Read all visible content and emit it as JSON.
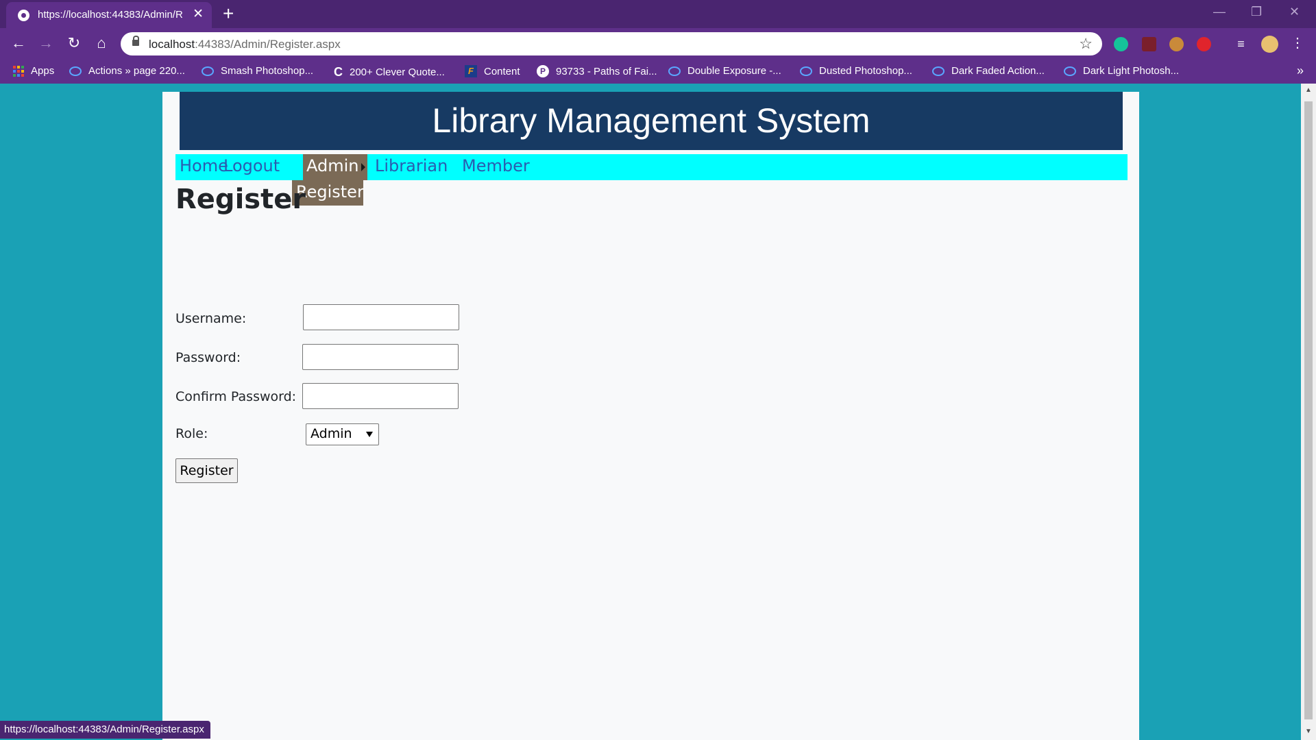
{
  "browser": {
    "tab_title": "https://localhost:44383/Admin/R",
    "new_tab": "+",
    "url_host": "localhost",
    "url_rest": ":44383/Admin/Register.aspx",
    "back": "←",
    "forward": "→",
    "reload": "↻",
    "home": "⌂",
    "star": "☆",
    "menu": "⋮",
    "window_min": "—",
    "window_max": "❐",
    "window_close": "✕",
    "bookmarks_more": "»",
    "status_url": "https://localhost:44383/Admin/Register.aspx"
  },
  "bookmarks": [
    {
      "label": "Apps",
      "icon": "apps-icon"
    },
    {
      "label": "Actions » page 220...",
      "icon": "bookmark-icon"
    },
    {
      "label": "Smash Photoshop...",
      "icon": "bookmark-icon"
    },
    {
      "label": "200+ Clever Quote...",
      "icon": "c-icon"
    },
    {
      "label": "Content",
      "icon": "f-icon"
    },
    {
      "label": "93733 - Paths of Fai...",
      "icon": "p-icon"
    },
    {
      "label": "Double Exposure -...",
      "icon": "bookmark-icon"
    },
    {
      "label": "Dusted Photoshop...",
      "icon": "bookmark-icon"
    },
    {
      "label": "Dark Faded Action...",
      "icon": "bookmark-icon"
    },
    {
      "label": "Dark Light Photosh...",
      "icon": "bookmark-icon"
    }
  ],
  "site": {
    "title": "Library Management System",
    "menu": {
      "home": "Home",
      "logout": "Logout",
      "admin": "Admin",
      "librarian": "Librarian",
      "member": "Member",
      "submenu_register": "Register"
    }
  },
  "form": {
    "heading": "Register",
    "username_label": "Username:",
    "username_value": "",
    "password_label": "Password:",
    "password_value": "",
    "confirm_label": "Confirm Password:",
    "confirm_value": "",
    "role_label": "Role:",
    "role_selected": "Admin",
    "submit_label": "Register"
  },
  "colors": {
    "page_bg": "#1aa1b5",
    "banner": "#173a63",
    "menubar": "#00ffff",
    "menu_active": "#7b6a56",
    "menu_link": "#2a5db0"
  }
}
